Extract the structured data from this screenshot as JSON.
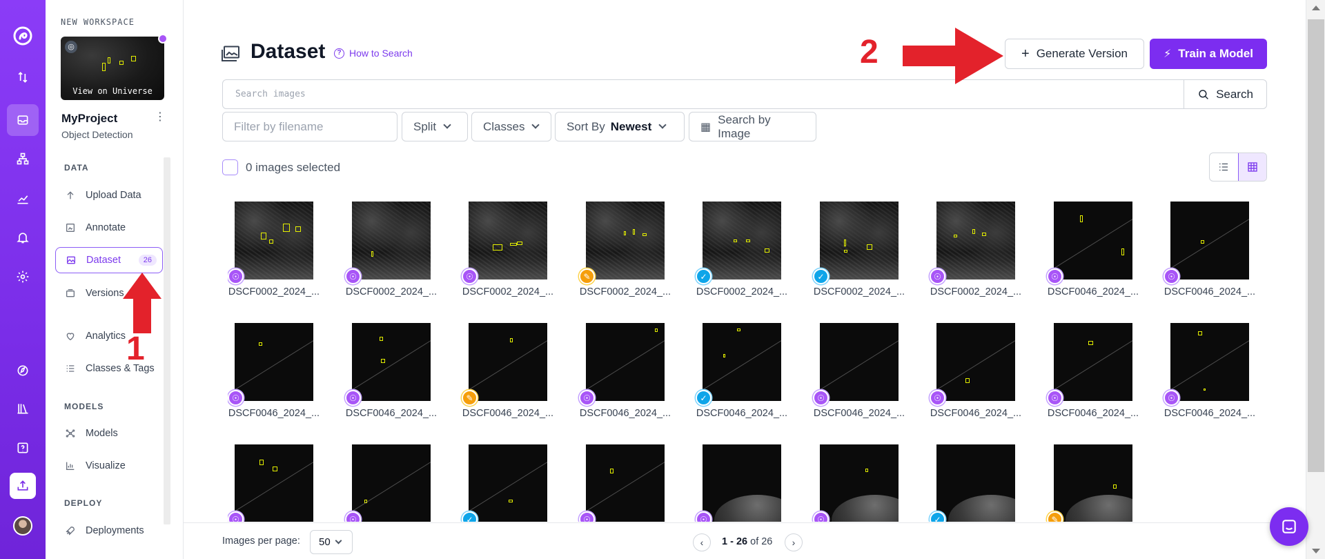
{
  "rail": {
    "items": [
      "logo-icon",
      "swap-icon",
      "inbox-icon",
      "hierarchy-icon",
      "chart-icon",
      "bell-icon",
      "gear-icon",
      "compass-icon",
      "library-icon",
      "help-icon",
      "upload-icon"
    ]
  },
  "sidebar": {
    "workspace_label": "NEW WORKSPACE",
    "view_universe": "View on Universe",
    "project_name": "MyProject",
    "project_type": "Object Detection",
    "sections": {
      "data": "DATA",
      "models": "MODELS",
      "deploy": "DEPLOY"
    },
    "items": [
      {
        "label": "Upload Data",
        "icon": "upload-arrow-icon"
      },
      {
        "label": "Annotate",
        "icon": "annotate-icon"
      },
      {
        "label": "Dataset",
        "icon": "image-icon",
        "badge": "26"
      },
      {
        "label": "Versions",
        "icon": "versions-icon"
      },
      {
        "label": "Analytics",
        "icon": "heart-icon"
      },
      {
        "label": "Classes & Tags",
        "icon": "list-icon"
      },
      {
        "label": "Models",
        "icon": "models-icon"
      },
      {
        "label": "Visualize",
        "icon": "visualize-icon"
      },
      {
        "label": "Deployments",
        "icon": "rocket-icon"
      }
    ]
  },
  "annotations": {
    "one": "1",
    "two": "2"
  },
  "header": {
    "title": "Dataset",
    "how_to_search": "How to Search",
    "generate_version": "Generate Version",
    "train_model": "Train a Model"
  },
  "search": {
    "placeholder": "Search images",
    "button": "Search"
  },
  "filters": {
    "filename_placeholder": "Filter by filename",
    "split": "Split",
    "classes": "Classes",
    "sort_label": "Sort By",
    "sort_value": "Newest",
    "search_by_image": "Search by Image"
  },
  "selection": {
    "label": "0 images selected"
  },
  "images": [
    {
      "name": "DSCF0002_2024_...",
      "status": "walk"
    },
    {
      "name": "DSCF0002_2024_...",
      "status": "walk"
    },
    {
      "name": "DSCF0002_2024_...",
      "status": "walk"
    },
    {
      "name": "DSCF0002_2024_...",
      "status": "edit"
    },
    {
      "name": "DSCF0002_2024_...",
      "status": "ok"
    },
    {
      "name": "DSCF0002_2024_...",
      "status": "ok"
    },
    {
      "name": "DSCF0002_2024_...",
      "status": "walk"
    },
    {
      "name": "DSCF0046_2024_...",
      "status": "walk"
    },
    {
      "name": "DSCF0046_2024_...",
      "status": "walk"
    },
    {
      "name": "DSCF0046_2024_...",
      "status": "walk"
    },
    {
      "name": "DSCF0046_2024_...",
      "status": "walk"
    },
    {
      "name": "DSCF0046_2024_...",
      "status": "edit"
    },
    {
      "name": "DSCF0046_2024_...",
      "status": "walk"
    },
    {
      "name": "DSCF0046_2024_...",
      "status": "ok"
    },
    {
      "name": "DSCF0046_2024_...",
      "status": "walk"
    },
    {
      "name": "DSCF0046_2024_...",
      "status": "walk"
    },
    {
      "name": "DSCF0046_2024_...",
      "status": "walk"
    },
    {
      "name": "DSCF0046_2024_...",
      "status": "walk"
    },
    {
      "name": "",
      "status": "walk"
    },
    {
      "name": "",
      "status": "walk"
    },
    {
      "name": "",
      "status": "ok"
    },
    {
      "name": "",
      "status": "walk"
    },
    {
      "name": "",
      "status": "walk"
    },
    {
      "name": "",
      "status": "walk"
    },
    {
      "name": "",
      "status": "ok"
    },
    {
      "name": "",
      "status": "edit"
    }
  ],
  "pagination": {
    "per_page_label": "Images per page:",
    "per_page_value": "50",
    "range": "1 - 26",
    "of_text": "of 26"
  },
  "colors": {
    "brand": "#7c2df0",
    "annotation_red": "#e3222b",
    "bbox": "#e5f000"
  }
}
